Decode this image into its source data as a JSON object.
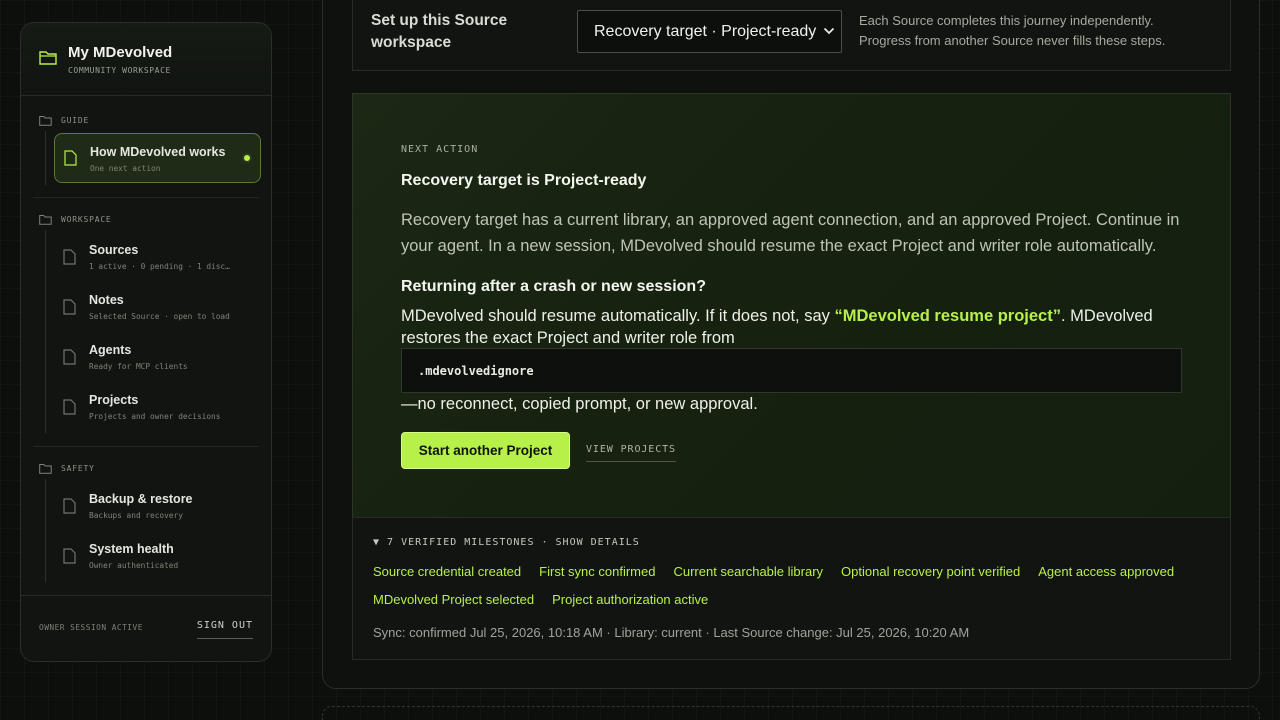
{
  "sidebar": {
    "brand_title": "My MDevolved",
    "brand_sub": "COMMUNITY WORKSPACE",
    "sections": [
      {
        "label": "GUIDE",
        "items": [
          {
            "title": "How MDevolved works",
            "sub": "One next action"
          }
        ]
      },
      {
        "label": "WORKSPACE",
        "items": [
          {
            "title": "Sources",
            "sub": "1 active · 0 pending · 1 disc…"
          },
          {
            "title": "Notes",
            "sub": "Selected Source · open to load"
          },
          {
            "title": "Agents",
            "sub": "Ready for MCP clients"
          },
          {
            "title": "Projects",
            "sub": "Projects and owner decisions"
          }
        ]
      },
      {
        "label": "SAFETY",
        "items": [
          {
            "title": "Backup & restore",
            "sub": "Backups and recovery"
          },
          {
            "title": "System health",
            "sub": "Owner authenticated"
          }
        ]
      }
    ],
    "session_label": "OWNER SESSION ACTIVE",
    "sign_out": "SIGN OUT"
  },
  "setup": {
    "title": "Set up this Source workspace",
    "selected_source": "Recovery target · Project-ready",
    "note": "Each Source completes this journey independently. Progress from another Source never fills these steps."
  },
  "next_action": {
    "eyebrow": "NEXT ACTION",
    "title": "Recovery target is Project-ready",
    "body": "Recovery target has a current library, an approved agent connection, and an approved Project. Continue in your agent. In a new session, MDevolved should resume the exact Project and writer role automatically.",
    "crash_title": "Returning after a crash or new session?",
    "crash_body_pre": "MDevolved should resume automatically. If it does not, say ",
    "crash_phrase": "“MDevolved resume project”",
    "crash_body_post": ". MDevolved restores the exact Project and writer role from",
    "code": ".mdevolvedignore",
    "crash_tail": "—no reconnect, copied prompt, or new approval.",
    "primary_button": "Start another Project",
    "secondary_link": "VIEW PROJECTS"
  },
  "milestones": {
    "toggle": "▼ 7 VERIFIED MILESTONES · SHOW DETAILS",
    "row1": [
      "Source credential created",
      "First sync confirmed",
      "Current searchable library",
      "Optional recovery point verified",
      "Agent access approved"
    ],
    "row2": [
      "MDevolved Project selected",
      "Project authorization active"
    ],
    "status": "Sync: confirmed Jul 25, 2026, 10:18 AM · Library: current · Last Source change: Jul 25, 2026, 10:20 AM"
  },
  "colors": {
    "accent": "#b8f04a",
    "background": "#0c0f0c",
    "panel": "#1b2815"
  }
}
